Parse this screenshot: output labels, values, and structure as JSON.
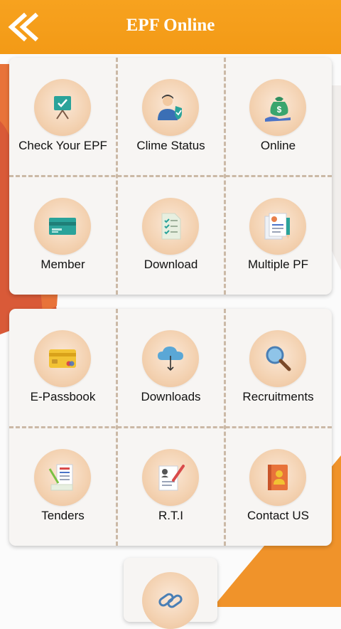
{
  "header": {
    "title": "EPF Online",
    "back_icon": "double-chevron-left-icon"
  },
  "colors": {
    "header": "#f39a16",
    "accent_red": "#d65a3a",
    "accent_orange": "#f0932a",
    "tile_circle": "#f3d1b0",
    "divider": "#cbb9a6"
  },
  "grid1": [
    {
      "label": "Check Your EPF",
      "icon": "checklist-board-icon"
    },
    {
      "label": "Clime Status",
      "icon": "officer-with-shield-icon"
    },
    {
      "label": "Online",
      "icon": "money-bag-hand-icon"
    },
    {
      "label": "Member",
      "icon": "member-card-icon"
    },
    {
      "label": "Download",
      "icon": "document-checklist-icon"
    },
    {
      "label": "Multiple PF",
      "icon": "resume-documents-icon"
    }
  ],
  "grid2": [
    {
      "label": "E-Passbook",
      "icon": "credit-card-icon"
    },
    {
      "label": "Downloads",
      "icon": "cloud-download-icon"
    },
    {
      "label": "Recruitments",
      "icon": "magnifier-icon"
    },
    {
      "label": "Tenders",
      "icon": "tender-documents-icon"
    },
    {
      "label": "R.T.I",
      "icon": "form-with-pen-icon"
    },
    {
      "label": "Contact US",
      "icon": "address-book-icon"
    }
  ],
  "extra_tile": {
    "icon": "link-chain-icon"
  }
}
